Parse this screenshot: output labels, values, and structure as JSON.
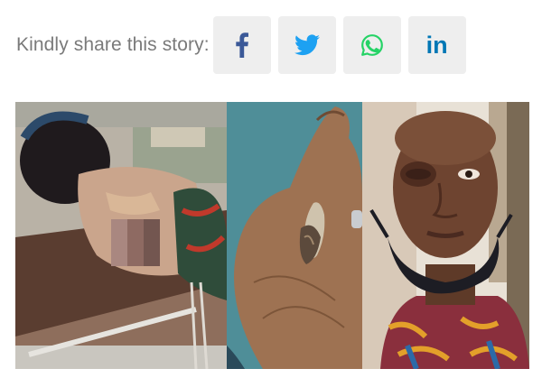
{
  "share": {
    "label": "Kindly share this story:",
    "buttons": [
      {
        "network": "facebook",
        "icon": "facebook-icon",
        "color": "#3b5998"
      },
      {
        "network": "twitter",
        "icon": "twitter-icon",
        "color": "#1da1f2"
      },
      {
        "network": "whatsapp",
        "icon": "whatsapp-icon",
        "color": "#25d366"
      },
      {
        "network": "linkedin",
        "icon": "linkedin-icon",
        "color": "#0077b5",
        "glyph": "in"
      }
    ]
  },
  "photo": {
    "panels": [
      "injured-woman-on-hospital-bed",
      "hand-holding-bullet-fragment",
      "man-with-swollen-eye"
    ]
  }
}
